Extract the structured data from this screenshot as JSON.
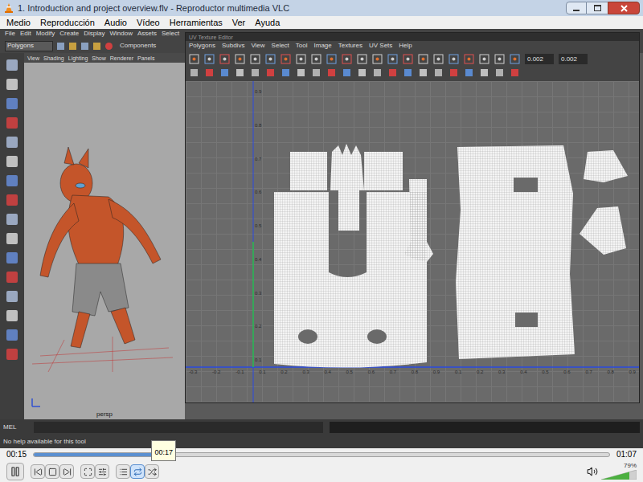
{
  "window": {
    "title": "1. Introduction and project overview.flv - Reproductor multimedia VLC"
  },
  "menu": [
    "Medio",
    "Reproducción",
    "Audio",
    "Vídeo",
    "Herramientas",
    "Ver",
    "Ayuda"
  ],
  "video": {
    "maya": {
      "menu": [
        "File",
        "Edit",
        "Modify",
        "Create",
        "Display",
        "Window",
        "Assets",
        "Select"
      ],
      "mode_dropdown": "Polygons",
      "components_label": "Components",
      "viewport_menu": [
        "View",
        "Shading",
        "Lighting",
        "Show",
        "Renderer",
        "Panels"
      ],
      "camera_label": "persp",
      "uv_editor": {
        "title": "UV Texture Editor",
        "menu": [
          "Polygons",
          "Subdivs",
          "View",
          "Select",
          "Tool",
          "Image",
          "Textures",
          "UV Sets",
          "Help"
        ],
        "fields": [
          "0.002",
          "0.002"
        ],
        "ticks_x": [
          "-0.3",
          "-0.2",
          "-0.1",
          "0.1",
          "0.2",
          "0.3",
          "0.4",
          "0.5",
          "0.6",
          "0.7",
          "0.8",
          "0.9",
          "0.1",
          "0.2",
          "0.3",
          "0.4",
          "0.5",
          "0.6",
          "0.7",
          "0.8",
          "0.9"
        ],
        "ticks_y": [
          "0.9",
          "0.8",
          "0.7",
          "0.6",
          "0.5",
          "0.4",
          "0.3",
          "0.2",
          "0.1"
        ]
      },
      "command_label": "MEL",
      "help_line": "No help available for this tool"
    }
  },
  "seek": {
    "elapsed": "00:15",
    "total": "01:07",
    "tooltip": "00:17",
    "level": 0.224
  },
  "controls": [
    {
      "kind": "pause",
      "selected": false
    },
    {
      "kind": "previous",
      "selected": false
    },
    {
      "kind": "stop",
      "selected": false
    },
    {
      "kind": "next",
      "selected": false
    },
    {
      "kind": "fullscreen",
      "selected": false
    },
    {
      "kind": "extended",
      "selected": false
    },
    {
      "kind": "playlist",
      "selected": false
    },
    {
      "kind": "loop",
      "selected": true
    },
    {
      "kind": "random",
      "selected": false
    }
  ],
  "volume": {
    "reading": "79%",
    "level": 0.79
  }
}
